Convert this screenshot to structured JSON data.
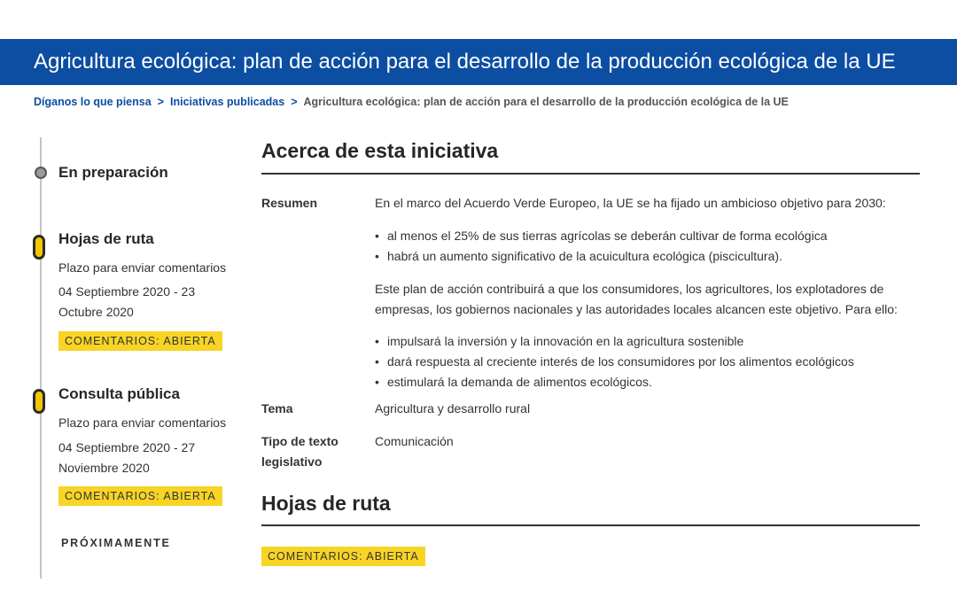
{
  "banner": {
    "title": "Agricultura ecológica: plan de acción para el desarrollo de la producción ecológica de la UE"
  },
  "breadcrumb": {
    "items": [
      "Díganos lo que piensa",
      "Iniciativas publicadas"
    ],
    "current": "Agricultura ecológica: plan de acción para el desarrollo de la producción ecológica de la UE",
    "separator": ">"
  },
  "timeline": {
    "stage1": {
      "title": "En preparación"
    },
    "stage2": {
      "title": "Hojas de ruta",
      "deadline_label": "Plazo para enviar comentarios",
      "dates_line1": "04 Septiembre 2020 - 23",
      "dates_line2": "Octubre 2020",
      "badge": "COMENTARIOS: ABIERTA"
    },
    "stage3": {
      "title": "Consulta pública",
      "deadline_label": "Plazo para enviar comentarios",
      "dates_line1": "04 Septiembre 2020 - 27",
      "dates_line2": "Noviembre 2020",
      "badge": "COMENTARIOS: ABIERTA"
    },
    "upcoming": "PRÓXIMAMENTE"
  },
  "about": {
    "heading": "Acerca de esta iniciativa",
    "summary_label": "Resumen",
    "summary_intro": "En el marco del Acuerdo Verde Europeo, la UE se ha fijado un ambicioso objetivo para 2030:",
    "goals": [
      "al menos el 25% de sus tierras agrícolas se deberán cultivar de forma ecológica",
      "habrá un aumento significativo de la acuicultura ecológica (piscicultura)."
    ],
    "summary_para2": "Este plan de acción contribuirá a que los consumidores, los agricultores, los explotadores de empresas, los gobiernos nacionales y las autoridades locales alcancen este objetivo. Para ello:",
    "actions": [
      "impulsará la inversión y la innovación en la agricultura sostenible",
      "dará respuesta al creciente interés de los consumidores por los alimentos ecológicos",
      "estimulará la demanda de alimentos ecológicos."
    ],
    "topic_label": "Tema",
    "topic_value": "Agricultura y desarrollo rural",
    "type_label_1": "Tipo de texto",
    "type_label_2": "legislativo",
    "type_value": "Comunicación"
  },
  "roadmaps": {
    "heading": "Hojas de ruta",
    "badge": "COMENTARIOS: ABIERTA"
  },
  "colors": {
    "banner": "#0c4ea2",
    "badge": "#f7d425",
    "pill": "#f2c700"
  }
}
